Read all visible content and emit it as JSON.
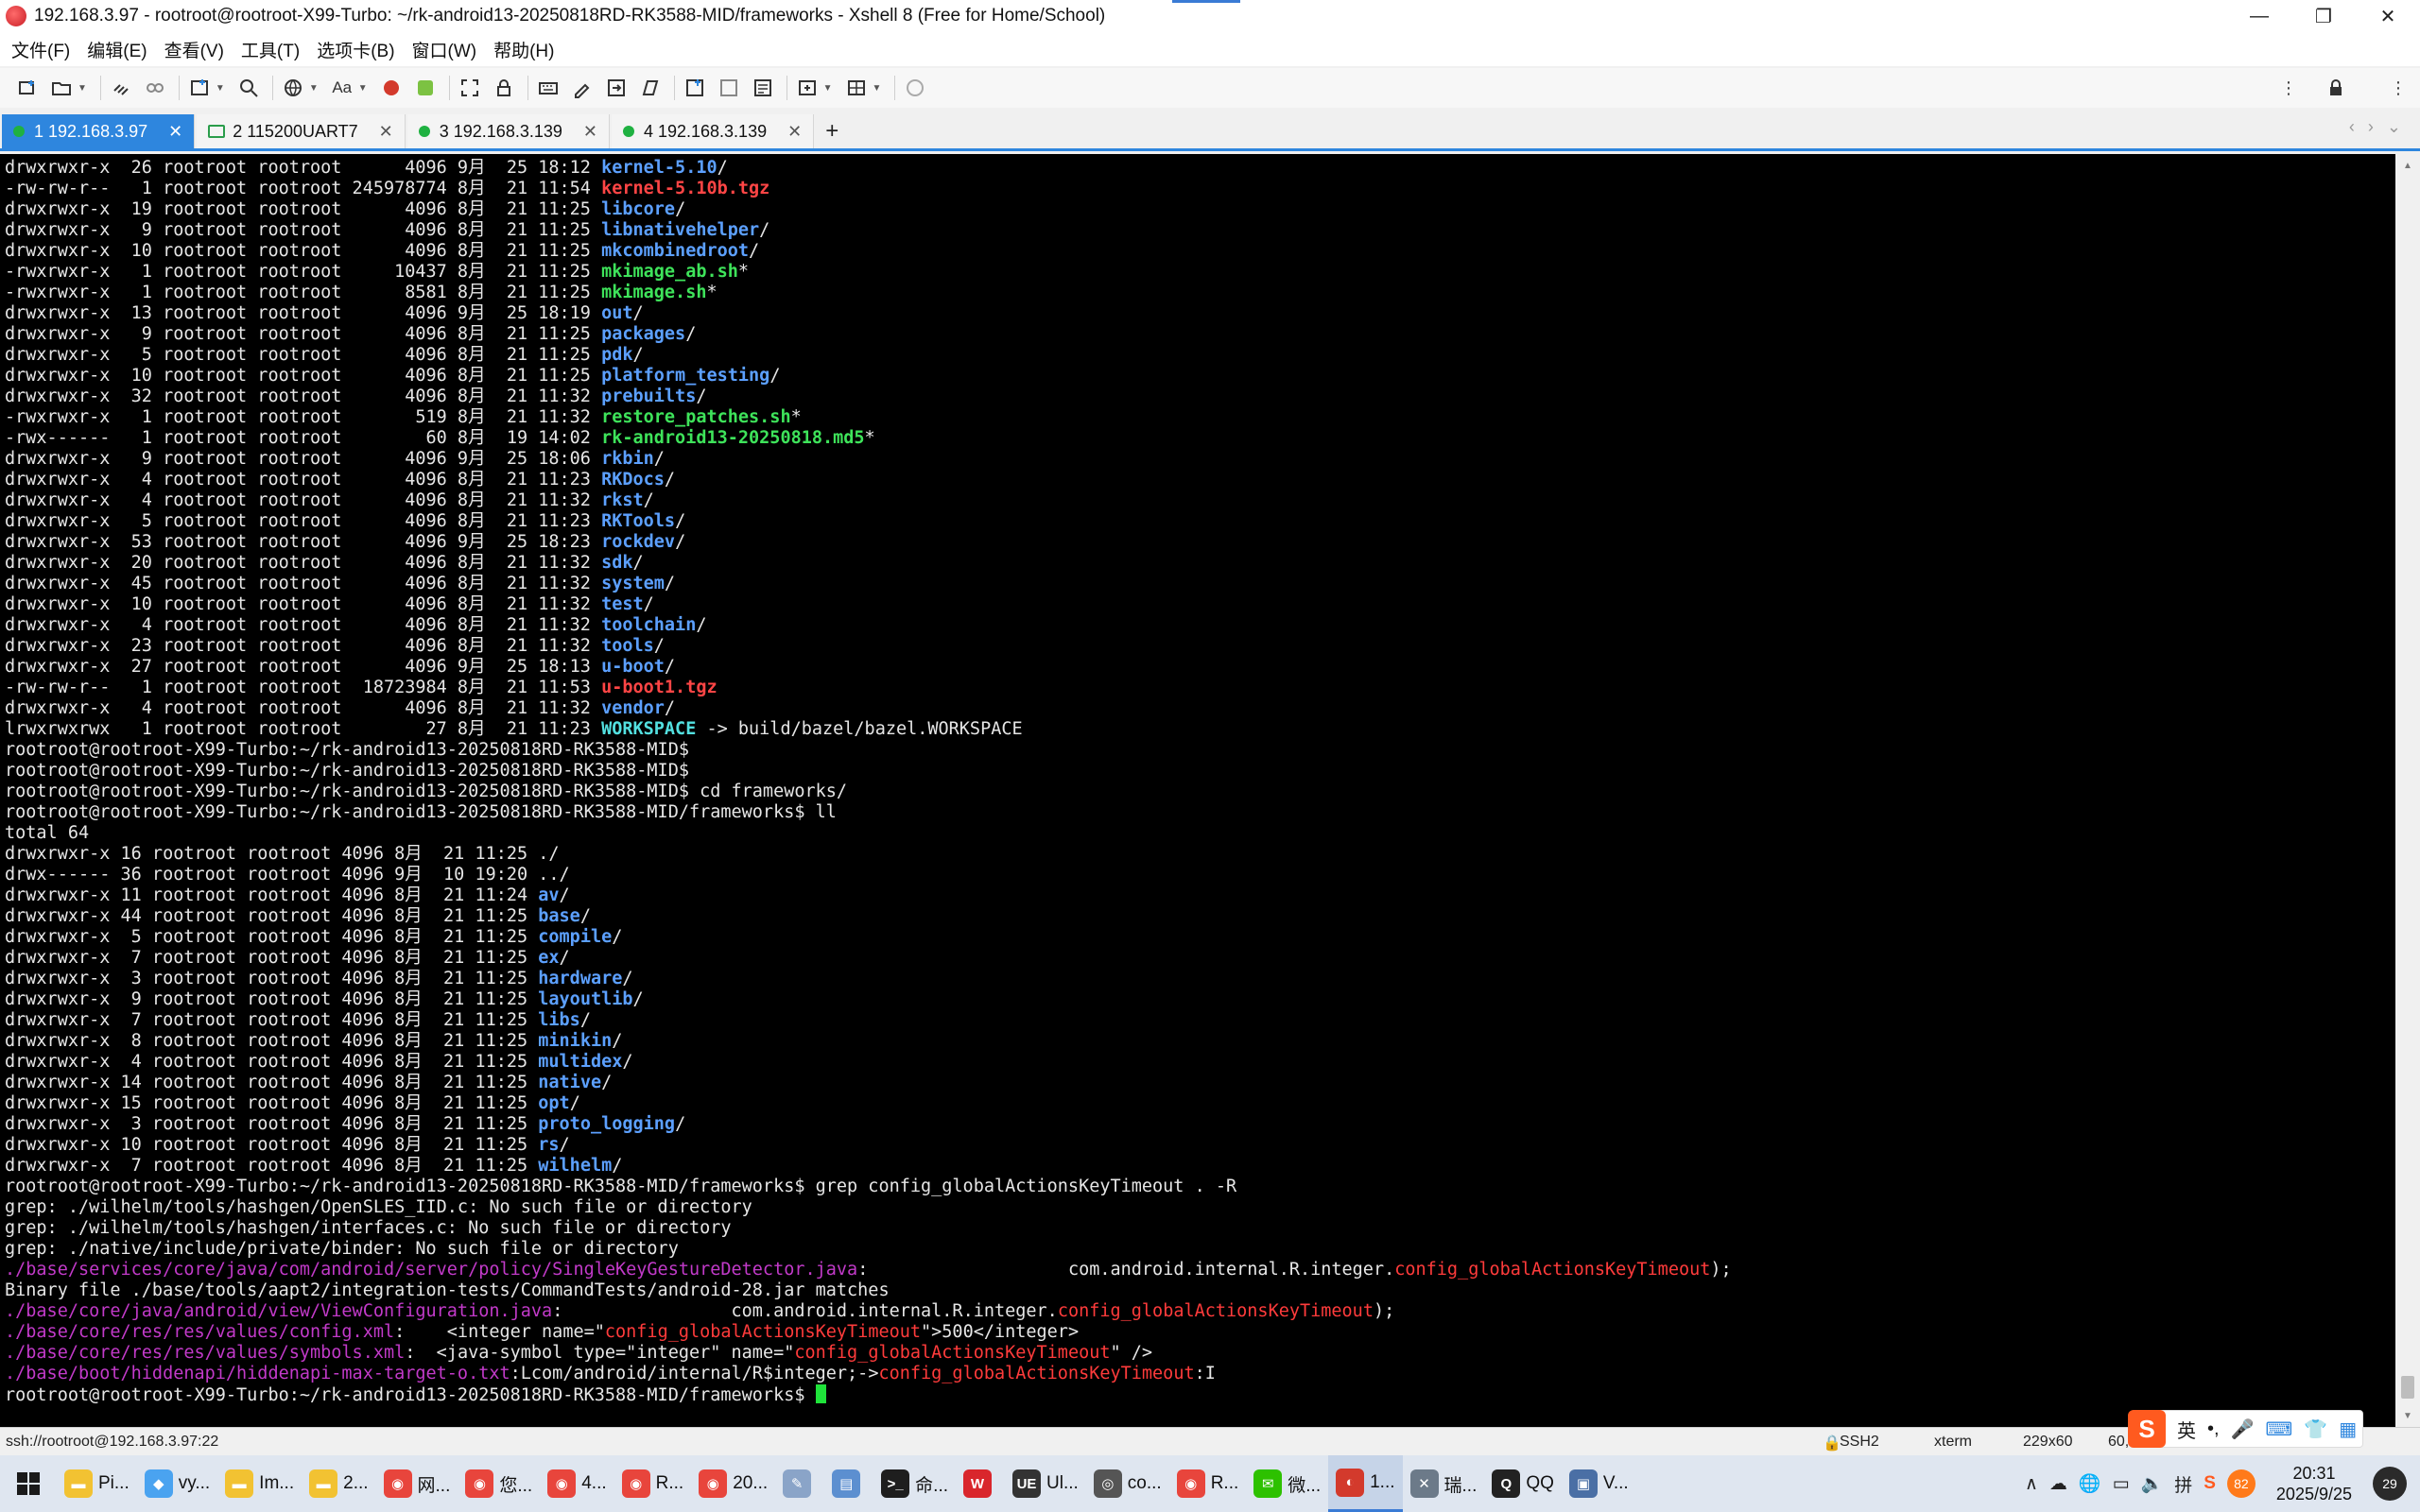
{
  "window": {
    "title": "192.168.3.97 - rootroot@rootroot-X99-Turbo: ~/rk-android13-20250818RD-RK3588-MID/frameworks - Xshell 8 (Free for Home/School)",
    "minimize": "—",
    "maximize": "❐",
    "close": "✕"
  },
  "menu": [
    "文件(F)",
    "编辑(E)",
    "查看(V)",
    "工具(T)",
    "选项卡(B)",
    "窗口(W)",
    "帮助(H)"
  ],
  "tabs": [
    {
      "label": "1 192.168.3.97",
      "status": "connected"
    },
    {
      "label": "2 115200UART7",
      "status": "serial"
    },
    {
      "label": "3 192.168.3.139",
      "status": "connected"
    },
    {
      "label": "4 192.168.3.139",
      "status": "connected"
    }
  ],
  "tab_add": "+",
  "terminal": {
    "lines": [
      [
        {
          "t": "drwxrwxr-x  26 rootroot rootroot      4096 9月  25 18:12 "
        },
        {
          "t": "kernel-5.10",
          "c": "dir"
        },
        {
          "t": "/"
        }
      ],
      [
        {
          "t": "-rw-rw-r--   1 rootroot rootroot 245978774 8月  21 11:54 "
        },
        {
          "t": "kernel-5.10b.tgz",
          "c": "arc"
        }
      ],
      [
        {
          "t": "drwxrwxr-x  19 rootroot rootroot      4096 8月  21 11:25 "
        },
        {
          "t": "libcore",
          "c": "dir"
        },
        {
          "t": "/"
        }
      ],
      [
        {
          "t": "drwxrwxr-x   9 rootroot rootroot      4096 8月  21 11:25 "
        },
        {
          "t": "libnativehelper",
          "c": "dir"
        },
        {
          "t": "/"
        }
      ],
      [
        {
          "t": "drwxrwxr-x  10 rootroot rootroot      4096 8月  21 11:25 "
        },
        {
          "t": "mkcombinedroot",
          "c": "dir"
        },
        {
          "t": "/"
        }
      ],
      [
        {
          "t": "-rwxrwxr-x   1 rootroot rootroot     10437 8月  21 11:25 "
        },
        {
          "t": "mkimage_ab.sh",
          "c": "exe"
        },
        {
          "t": "*"
        }
      ],
      [
        {
          "t": "-rwxrwxr-x   1 rootroot rootroot      8581 8月  21 11:25 "
        },
        {
          "t": "mkimage.sh",
          "c": "exe"
        },
        {
          "t": "*"
        }
      ],
      [
        {
          "t": "drwxrwxr-x  13 rootroot rootroot      4096 9月  25 18:19 "
        },
        {
          "t": "out",
          "c": "dir"
        },
        {
          "t": "/"
        }
      ],
      [
        {
          "t": "drwxrwxr-x   9 rootroot rootroot      4096 8月  21 11:25 "
        },
        {
          "t": "packages",
          "c": "dir"
        },
        {
          "t": "/"
        }
      ],
      [
        {
          "t": "drwxrwxr-x   5 rootroot rootroot      4096 8月  21 11:25 "
        },
        {
          "t": "pdk",
          "c": "dir"
        },
        {
          "t": "/"
        }
      ],
      [
        {
          "t": "drwxrwxr-x  10 rootroot rootroot      4096 8月  21 11:25 "
        },
        {
          "t": "platform_testing",
          "c": "dir"
        },
        {
          "t": "/"
        }
      ],
      [
        {
          "t": "drwxrwxr-x  32 rootroot rootroot      4096 8月  21 11:32 "
        },
        {
          "t": "prebuilts",
          "c": "dir"
        },
        {
          "t": "/"
        }
      ],
      [
        {
          "t": "-rwxrwxr-x   1 rootroot rootroot       519 8月  21 11:32 "
        },
        {
          "t": "restore_patches.sh",
          "c": "exe"
        },
        {
          "t": "*"
        }
      ],
      [
        {
          "t": "-rwx------   1 rootroot rootroot        60 8月  19 14:02 "
        },
        {
          "t": "rk-android13-20250818.md5",
          "c": "exe"
        },
        {
          "t": "*"
        }
      ],
      [
        {
          "t": "drwxrwxr-x   9 rootroot rootroot      4096 9月  25 18:06 "
        },
        {
          "t": "rkbin",
          "c": "dir"
        },
        {
          "t": "/"
        }
      ],
      [
        {
          "t": "drwxrwxr-x   4 rootroot rootroot      4096 8月  21 11:23 "
        },
        {
          "t": "RKDocs",
          "c": "dir"
        },
        {
          "t": "/"
        }
      ],
      [
        {
          "t": "drwxrwxr-x   4 rootroot rootroot      4096 8月  21 11:32 "
        },
        {
          "t": "rkst",
          "c": "dir"
        },
        {
          "t": "/"
        }
      ],
      [
        {
          "t": "drwxrwxr-x   5 rootroot rootroot      4096 8月  21 11:23 "
        },
        {
          "t": "RKTools",
          "c": "dir"
        },
        {
          "t": "/"
        }
      ],
      [
        {
          "t": "drwxrwxr-x  53 rootroot rootroot      4096 9月  25 18:23 "
        },
        {
          "t": "rockdev",
          "c": "dir"
        },
        {
          "t": "/"
        }
      ],
      [
        {
          "t": "drwxrwxr-x  20 rootroot rootroot      4096 8月  21 11:32 "
        },
        {
          "t": "sdk",
          "c": "dir"
        },
        {
          "t": "/"
        }
      ],
      [
        {
          "t": "drwxrwxr-x  45 rootroot rootroot      4096 8月  21 11:32 "
        },
        {
          "t": "system",
          "c": "dir"
        },
        {
          "t": "/"
        }
      ],
      [
        {
          "t": "drwxrwxr-x  10 rootroot rootroot      4096 8月  21 11:32 "
        },
        {
          "t": "test",
          "c": "dir"
        },
        {
          "t": "/"
        }
      ],
      [
        {
          "t": "drwxrwxr-x   4 rootroot rootroot      4096 8月  21 11:32 "
        },
        {
          "t": "toolchain",
          "c": "dir"
        },
        {
          "t": "/"
        }
      ],
      [
        {
          "t": "drwxrwxr-x  23 rootroot rootroot      4096 8月  21 11:32 "
        },
        {
          "t": "tools",
          "c": "dir"
        },
        {
          "t": "/"
        }
      ],
      [
        {
          "t": "drwxrwxr-x  27 rootroot rootroot      4096 9月  25 18:13 "
        },
        {
          "t": "u-boot",
          "c": "dir"
        },
        {
          "t": "/"
        }
      ],
      [
        {
          "t": "-rw-rw-r--   1 rootroot rootroot  18723984 8月  21 11:53 "
        },
        {
          "t": "u-boot1.tgz",
          "c": "arc"
        }
      ],
      [
        {
          "t": "drwxrwxr-x   4 rootroot rootroot      4096 8月  21 11:32 "
        },
        {
          "t": "vendor",
          "c": "dir"
        },
        {
          "t": "/"
        }
      ],
      [
        {
          "t": "lrwxrwxrwx   1 rootroot rootroot        27 8月  21 11:23 "
        },
        {
          "t": "WORKSPACE",
          "c": "lnk"
        },
        {
          "t": " -> build/bazel/bazel.WORKSPACE"
        }
      ],
      [
        {
          "t": "rootroot@rootroot-X99-Turbo:~/rk-android13-20250818RD-RK3588-MID$"
        }
      ],
      [
        {
          "t": "rootroot@rootroot-X99-Turbo:~/rk-android13-20250818RD-RK3588-MID$"
        }
      ],
      [
        {
          "t": "rootroot@rootroot-X99-Turbo:~/rk-android13-20250818RD-RK3588-MID$ cd frameworks/"
        }
      ],
      [
        {
          "t": "rootroot@rootroot-X99-Turbo:~/rk-android13-20250818RD-RK3588-MID/frameworks$ ll"
        }
      ],
      [
        {
          "t": "total 64"
        }
      ],
      [
        {
          "t": "drwxrwxr-x 16 rootroot rootroot 4096 8月  21 11:25 ./"
        }
      ],
      [
        {
          "t": "drwx------ 36 rootroot rootroot 4096 9月  10 19:20 ../"
        }
      ],
      [
        {
          "t": "drwxrwxr-x 11 rootroot rootroot 4096 8月  21 11:24 "
        },
        {
          "t": "av",
          "c": "dir"
        },
        {
          "t": "/"
        }
      ],
      [
        {
          "t": "drwxrwxr-x 44 rootroot rootroot 4096 8月  21 11:25 "
        },
        {
          "t": "base",
          "c": "dir"
        },
        {
          "t": "/"
        }
      ],
      [
        {
          "t": "drwxrwxr-x  5 rootroot rootroot 4096 8月  21 11:25 "
        },
        {
          "t": "compile",
          "c": "dir"
        },
        {
          "t": "/"
        }
      ],
      [
        {
          "t": "drwxrwxr-x  7 rootroot rootroot 4096 8月  21 11:25 "
        },
        {
          "t": "ex",
          "c": "dir"
        },
        {
          "t": "/"
        }
      ],
      [
        {
          "t": "drwxrwxr-x  3 rootroot rootroot 4096 8月  21 11:25 "
        },
        {
          "t": "hardware",
          "c": "dir"
        },
        {
          "t": "/"
        }
      ],
      [
        {
          "t": "drwxrwxr-x  9 rootroot rootroot 4096 8月  21 11:25 "
        },
        {
          "t": "layoutlib",
          "c": "dir"
        },
        {
          "t": "/"
        }
      ],
      [
        {
          "t": "drwxrwxr-x  7 rootroot rootroot 4096 8月  21 11:25 "
        },
        {
          "t": "libs",
          "c": "dir"
        },
        {
          "t": "/"
        }
      ],
      [
        {
          "t": "drwxrwxr-x  8 rootroot rootroot 4096 8月  21 11:25 "
        },
        {
          "t": "minikin",
          "c": "dir"
        },
        {
          "t": "/"
        }
      ],
      [
        {
          "t": "drwxrwxr-x  4 rootroot rootroot 4096 8月  21 11:25 "
        },
        {
          "t": "multidex",
          "c": "dir"
        },
        {
          "t": "/"
        }
      ],
      [
        {
          "t": "drwxrwxr-x 14 rootroot rootroot 4096 8月  21 11:25 "
        },
        {
          "t": "native",
          "c": "dir"
        },
        {
          "t": "/"
        }
      ],
      [
        {
          "t": "drwxrwxr-x 15 rootroot rootroot 4096 8月  21 11:25 "
        },
        {
          "t": "opt",
          "c": "dir"
        },
        {
          "t": "/"
        }
      ],
      [
        {
          "t": "drwxrwxr-x  3 rootroot rootroot 4096 8月  21 11:25 "
        },
        {
          "t": "proto_logging",
          "c": "dir"
        },
        {
          "t": "/"
        }
      ],
      [
        {
          "t": "drwxrwxr-x 10 rootroot rootroot 4096 8月  21 11:25 "
        },
        {
          "t": "rs",
          "c": "dir"
        },
        {
          "t": "/"
        }
      ],
      [
        {
          "t": "drwxrwxr-x  7 rootroot rootroot 4096 8月  21 11:25 "
        },
        {
          "t": "wilhelm",
          "c": "dir"
        },
        {
          "t": "/"
        }
      ],
      [
        {
          "t": "rootroot@rootroot-X99-Turbo:~/rk-android13-20250818RD-RK3588-MID/frameworks$ grep config_globalActionsKeyTimeout . -R"
        }
      ],
      [
        {
          "t": "grep: ./wilhelm/tools/hashgen/OpenSLES_IID.c: No such file or directory"
        }
      ],
      [
        {
          "t": "grep: ./wilhelm/tools/hashgen/interfaces.c: No such file or directory"
        }
      ],
      [
        {
          "t": "grep: ./native/include/private/binder: No such file or directory"
        }
      ],
      [
        {
          "t": "./base/services/core/java/com/android/server/policy/SingleKeyGestureDetector.java",
          "c": "path"
        },
        {
          "t": ":                   com.android.internal.R.integer."
        },
        {
          "t": "config_globalActionsKeyTimeout",
          "c": "match"
        },
        {
          "t": ");"
        }
      ],
      [
        {
          "t": "Binary file ./base/tools/aapt2/integration-tests/CommandTests/android-28.jar matches"
        }
      ],
      [
        {
          "t": "./base/core/java/android/view/ViewConfiguration.java",
          "c": "path"
        },
        {
          "t": ":                com.android.internal.R.integer."
        },
        {
          "t": "config_globalActionsKeyTimeout",
          "c": "match"
        },
        {
          "t": ");"
        }
      ],
      [
        {
          "t": "./base/core/res/res/values/config.xml",
          "c": "path"
        },
        {
          "t": ":    <integer name=\""
        },
        {
          "t": "config_globalActionsKeyTimeout",
          "c": "match"
        },
        {
          "t": "\">500</integer>"
        }
      ],
      [
        {
          "t": "./base/core/res/res/values/symbols.xml",
          "c": "path"
        },
        {
          "t": ":  <java-symbol type=\"integer\" name=\""
        },
        {
          "t": "config_globalActionsKeyTimeout",
          "c": "match"
        },
        {
          "t": "\" />"
        }
      ],
      [
        {
          "t": "./base/boot/hiddenapi/hiddenapi-max-target-o.txt",
          "c": "path"
        },
        {
          "t": ":Lcom/android/internal/R$integer;->"
        },
        {
          "t": "config_globalActionsKeyTimeout",
          "c": "match"
        },
        {
          "t": ":I"
        }
      ],
      [
        {
          "t": "rootroot@rootroot-X99-Turbo:~/rk-android13-20250818RD-RK3588-MID/frameworks$ "
        },
        {
          "t": "",
          "c": "cursor"
        }
      ]
    ],
    "colors": {
      "dir": "#5ca0ff",
      "exe": "#3ee35a",
      "arc": "#ff4545",
      "lnk": "#53e0e0",
      "path": "#c23ac9",
      "match": "#ff3b3b"
    }
  },
  "status": {
    "connection": "ssh://rootroot@192.168.3.97:22",
    "protocol": "SSH2",
    "terminal_type": "xterm",
    "size": "229x60",
    "cursor_pos": "60,"
  },
  "ime": {
    "logo": "S",
    "lang": "英"
  },
  "taskbar": {
    "apps": [
      {
        "label": "Pi...",
        "icon": "folder-icon",
        "color": "#f2c232"
      },
      {
        "label": "vy...",
        "icon": "cube-icon",
        "color": "#4aa3f0"
      },
      {
        "label": "Im...",
        "icon": "folder-icon",
        "color": "#f2c232"
      },
      {
        "label": "2...",
        "icon": "folder-icon",
        "color": "#f2c232"
      },
      {
        "label": "网...",
        "icon": "chrome-icon",
        "color": "#e8453c"
      },
      {
        "label": "您...",
        "icon": "chrome-icon",
        "color": "#e8453c"
      },
      {
        "label": "4...",
        "icon": "chrome-icon",
        "color": "#e8453c"
      },
      {
        "label": "R...",
        "icon": "chrome-icon",
        "color": "#e8453c"
      },
      {
        "label": "20...",
        "icon": "chrome-icon",
        "color": "#e8453c"
      },
      {
        "label": "",
        "icon": "paint-icon",
        "color": "#8aa4c8"
      },
      {
        "label": "",
        "icon": "notes-icon",
        "color": "#5c8fd0"
      },
      {
        "label": "命...",
        "icon": "cmd-icon",
        "color": "#1e1e1e"
      },
      {
        "label": "",
        "icon": "wps-icon",
        "color": "#d9262c"
      },
      {
        "label": "Ul...",
        "icon": "ultraedit-icon",
        "color": "#333333"
      },
      {
        "label": "co...",
        "icon": "webcam-icon",
        "color": "#555555"
      },
      {
        "label": "R...",
        "icon": "chrome-icon",
        "color": "#e8453c"
      },
      {
        "label": "微...",
        "icon": "wechat-icon",
        "color": "#2dc100"
      },
      {
        "label": "1...",
        "icon": "xshell-icon",
        "color": "#d33a2c"
      },
      {
        "label": "瑞...",
        "icon": "tools-icon",
        "color": "#6c7a89"
      },
      {
        "label": "QQ",
        "icon": "qq-icon",
        "color": "#222222"
      },
      {
        "label": "V...",
        "icon": "terminal-icon",
        "color": "#4a6fa5"
      }
    ],
    "tray": {
      "time": "20:31",
      "date": "2025/9/25",
      "badge": "82",
      "notifications": "29"
    }
  }
}
